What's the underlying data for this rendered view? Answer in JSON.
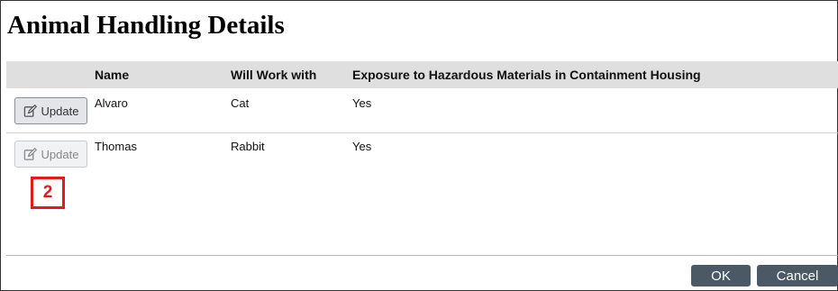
{
  "page": {
    "title": "Animal Handling Details"
  },
  "table": {
    "columns": [
      "Name",
      "Will Work with",
      "Exposure to Hazardous Materials in Containment Housing"
    ],
    "rows": [
      {
        "name": "Alvaro",
        "will_work_with": "Cat",
        "exposure": "Yes",
        "action_label": "Update"
      },
      {
        "name": "Thomas",
        "will_work_with": "Rabbit",
        "exposure": "Yes",
        "action_label": "Update"
      }
    ]
  },
  "annotation": {
    "callout_number": "2"
  },
  "footer": {
    "ok_label": "OK",
    "cancel_label": "Cancel"
  },
  "icons": {
    "update_icon": "edit-icon"
  }
}
